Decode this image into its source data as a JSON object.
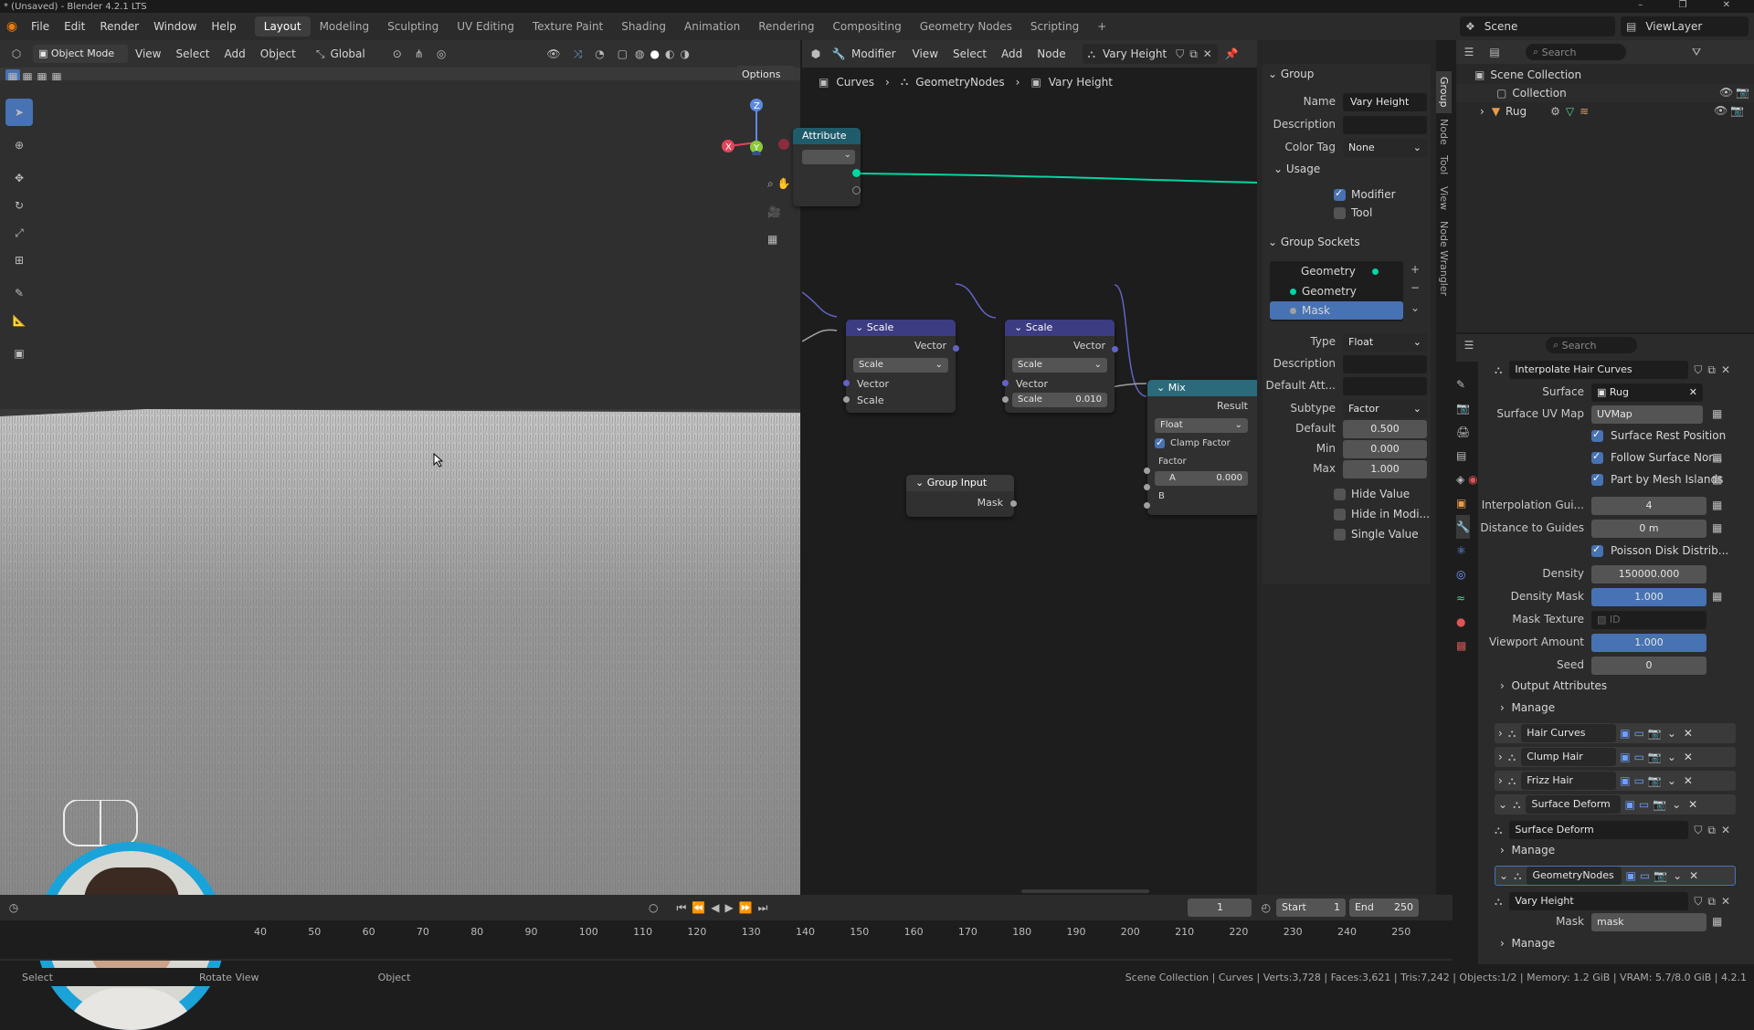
{
  "window": {
    "title": "* (Unsaved) - Blender 4.2.1 LTS"
  },
  "menus": [
    "File",
    "Edit",
    "Render",
    "Window",
    "Help"
  ],
  "workspaces": [
    "Layout",
    "Modeling",
    "Sculpting",
    "UV Editing",
    "Texture Paint",
    "Shading",
    "Animation",
    "Rendering",
    "Compositing",
    "Geometry Nodes",
    "Scripting"
  ],
  "scene": {
    "name": "Scene",
    "view_layer": "ViewLayer"
  },
  "viewport": {
    "mode": "Object Mode",
    "menu": [
      "View",
      "Select",
      "Add",
      "Object"
    ],
    "transform": "Global",
    "options": "Options"
  },
  "node_editor": {
    "editor": "Modifier",
    "menu": [
      "View",
      "Select",
      "Add",
      "Node"
    ],
    "tree": "Vary Height",
    "breadcrumb": [
      "Curves",
      "GeometryNodes",
      "Vary Height"
    ],
    "attr_node": {
      "title": "Attribute"
    },
    "scale1": {
      "title": "Scale",
      "out": "Vector",
      "mode": "Scale",
      "in1": "Vector",
      "in2": "Scale"
    },
    "scale2": {
      "title": "Scale",
      "out": "Vector",
      "mode": "Scale",
      "in1": "Vector",
      "in2": "Scale",
      "in2_val": "0.010"
    },
    "mix": {
      "title": "Mix",
      "out": "Result",
      "type": "Float",
      "clamp": "Clamp Factor",
      "factor": "Factor",
      "a": "A",
      "a_val": "0.000",
      "b": "B"
    },
    "group_input": {
      "title": "Group Input",
      "out": "Mask"
    }
  },
  "side_tabs": [
    "Group",
    "Node",
    "Tool",
    "View",
    "Node Wrangler"
  ],
  "group_panel": {
    "header": "Group",
    "name_label": "Name",
    "name_value": "Vary Height",
    "desc_label": "Description",
    "color_label": "Color Tag",
    "color_value": "None",
    "usage_header": "Usage",
    "modifier": "Modifier",
    "tool": "Tool",
    "sockets_header": "Group Sockets",
    "sockets": [
      "Geometry",
      "Geometry",
      "Mask"
    ],
    "type_label": "Type",
    "type_value": "Float",
    "desc2_label": "Description",
    "default_attr_label": "Default Att...",
    "subtype_label": "Subtype",
    "subtype_value": "Factor",
    "default_label": "Default",
    "default_value": "0.500",
    "min_label": "Min",
    "min_value": "0.000",
    "max_label": "Max",
    "max_value": "1.000",
    "hide_value": "Hide Value",
    "hide_modifier": "Hide in Modi...",
    "single_value": "Single Value"
  },
  "outliner": {
    "search": "Search",
    "root": "Scene Collection",
    "collection": "Collection",
    "object": "Rug"
  },
  "properties": {
    "search": "Search",
    "modifier_name": "Interpolate Hair Curves",
    "rows": [
      {
        "label": "Surface",
        "value": "Rug"
      },
      {
        "label": "Surface UV Map",
        "value": "UVMap"
      }
    ],
    "checks": [
      "Surface Rest Position",
      "Follow Surface Nor...",
      "Part by Mesh Islands"
    ],
    "interp_label": "Interpolation Gui...",
    "interp_value": "4",
    "dist_label": "Distance to Guides",
    "dist_value": "0 m",
    "poisson": "Poisson Disk Distrib...",
    "density_label": "Density",
    "density_value": "150000.000",
    "dmask_label": "Density Mask",
    "dmask_value": "1.000",
    "mtex_label": "Mask Texture",
    "mtex_value": "ID",
    "vp_label": "Viewport Amount",
    "vp_value": "1.000",
    "seed_label": "Seed",
    "seed_value": "0",
    "output_attrs": "Output Attributes",
    "manage": "Manage",
    "stack": [
      "Hair Curves Noise",
      "Clump Hair Curves",
      "Frizz Hair Curves",
      "Surface Deform"
    ],
    "surface_deform_sub": "Surface Deform",
    "manage2": "Manage",
    "geonodes": "GeometryNodes",
    "vary_height": "Vary Height",
    "mask_label": "Mask",
    "mask_value": "mask",
    "manage3": "Manage"
  },
  "timeline": {
    "frame": "1",
    "start_label": "Start",
    "start": "1",
    "end_label": "End",
    "end": "250",
    "ticks": [
      "40",
      "50",
      "60",
      "70",
      "80",
      "90",
      "100",
      "110",
      "120",
      "130",
      "140",
      "150",
      "160",
      "170",
      "180",
      "190",
      "200",
      "210",
      "220",
      "230",
      "240",
      "250"
    ]
  },
  "statusbar": {
    "select": "Select",
    "rotate": "Rotate View",
    "object": "Object",
    "info": "Scene Collection | Curves | Verts:3,728 | Faces:3,621 | Tris:7,242 | Objects:1/2 | Memory: 1.2 GiB | VRAM: 5.7/8.0 GiB | 4.2.1"
  },
  "colors": {
    "accent": "#4772b3",
    "geo_socket": "#00d6a3",
    "vector_socket": "#6363c7",
    "float_socket": "#a1a1a1"
  }
}
